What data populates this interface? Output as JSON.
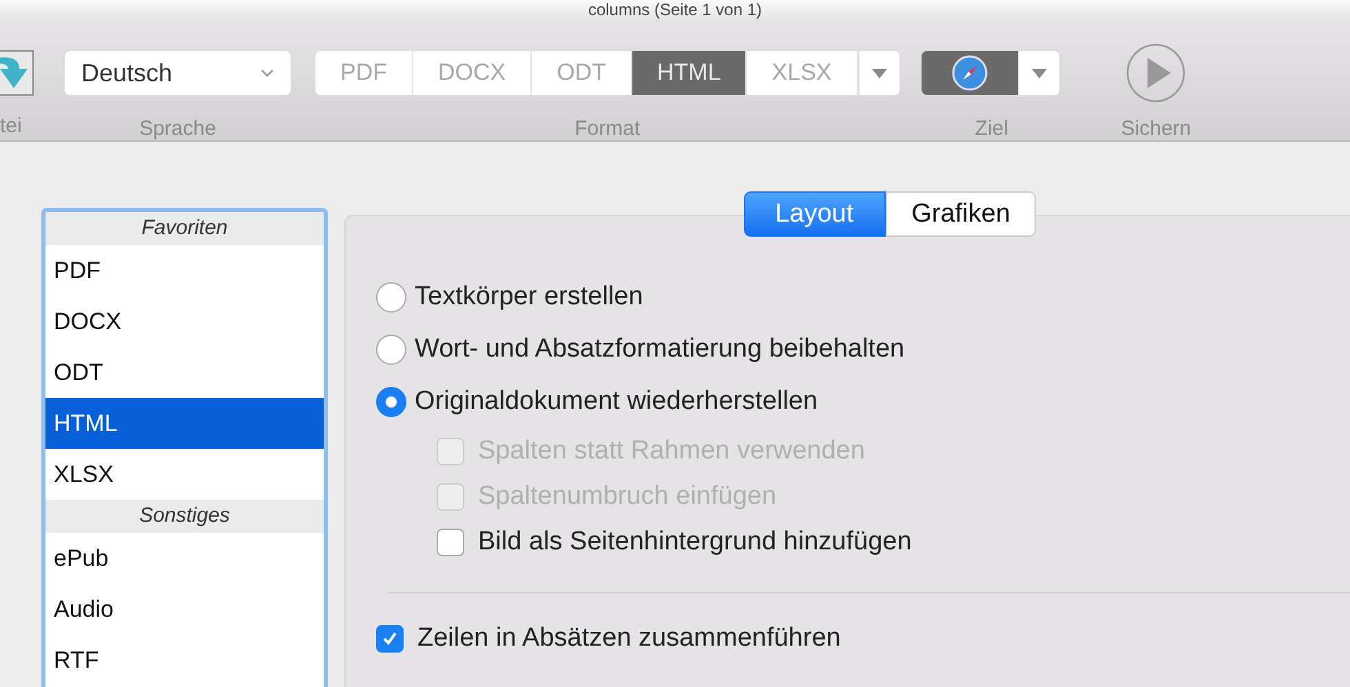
{
  "window": {
    "title": "columns (Seite 1 von 1)"
  },
  "toolbar": {
    "file_button": {
      "label": "tei"
    },
    "language": {
      "value": "Deutsch",
      "label": "Sprache"
    },
    "format": {
      "label": "Format",
      "segments": [
        {
          "text": "PDF",
          "selected": false
        },
        {
          "text": "DOCX",
          "selected": false
        },
        {
          "text": "ODT",
          "selected": false
        },
        {
          "text": "HTML",
          "selected": true
        },
        {
          "text": "XLSX",
          "selected": false
        }
      ]
    },
    "target": {
      "label": "Ziel"
    },
    "save": {
      "label": "Sichern"
    }
  },
  "sidebar": {
    "sections": [
      {
        "title": "Favoriten",
        "items": [
          {
            "text": "PDF",
            "selected": false
          },
          {
            "text": "DOCX",
            "selected": false
          },
          {
            "text": "ODT",
            "selected": false
          },
          {
            "text": "HTML",
            "selected": true
          },
          {
            "text": "XLSX",
            "selected": false
          }
        ]
      },
      {
        "title": "Sonstiges",
        "items": [
          {
            "text": "ePub",
            "selected": false
          },
          {
            "text": "Audio",
            "selected": false
          },
          {
            "text": "RTF",
            "selected": false
          }
        ]
      }
    ]
  },
  "tabs": [
    {
      "text": "Layout",
      "selected": true
    },
    {
      "text": "Grafiken",
      "selected": false
    }
  ],
  "options": [
    {
      "text": "Textkörper erstellen",
      "selected": false
    },
    {
      "text": "Wort- und Absatzformatierung beibehalten",
      "selected": false
    },
    {
      "text": "Originaldokument wiederherstellen",
      "selected": true,
      "children": [
        {
          "text": "Spalten statt Rahmen verwenden",
          "checked": false,
          "disabled": true
        },
        {
          "text": "Spaltenumbruch einfügen",
          "checked": false,
          "disabled": true
        },
        {
          "text": "Bild als Seitenhintergrund hinzufügen",
          "checked": false,
          "disabled": false
        }
      ]
    }
  ],
  "merge_lines": {
    "text": "Zeilen in Absätzen zusammenführen",
    "checked": true
  }
}
